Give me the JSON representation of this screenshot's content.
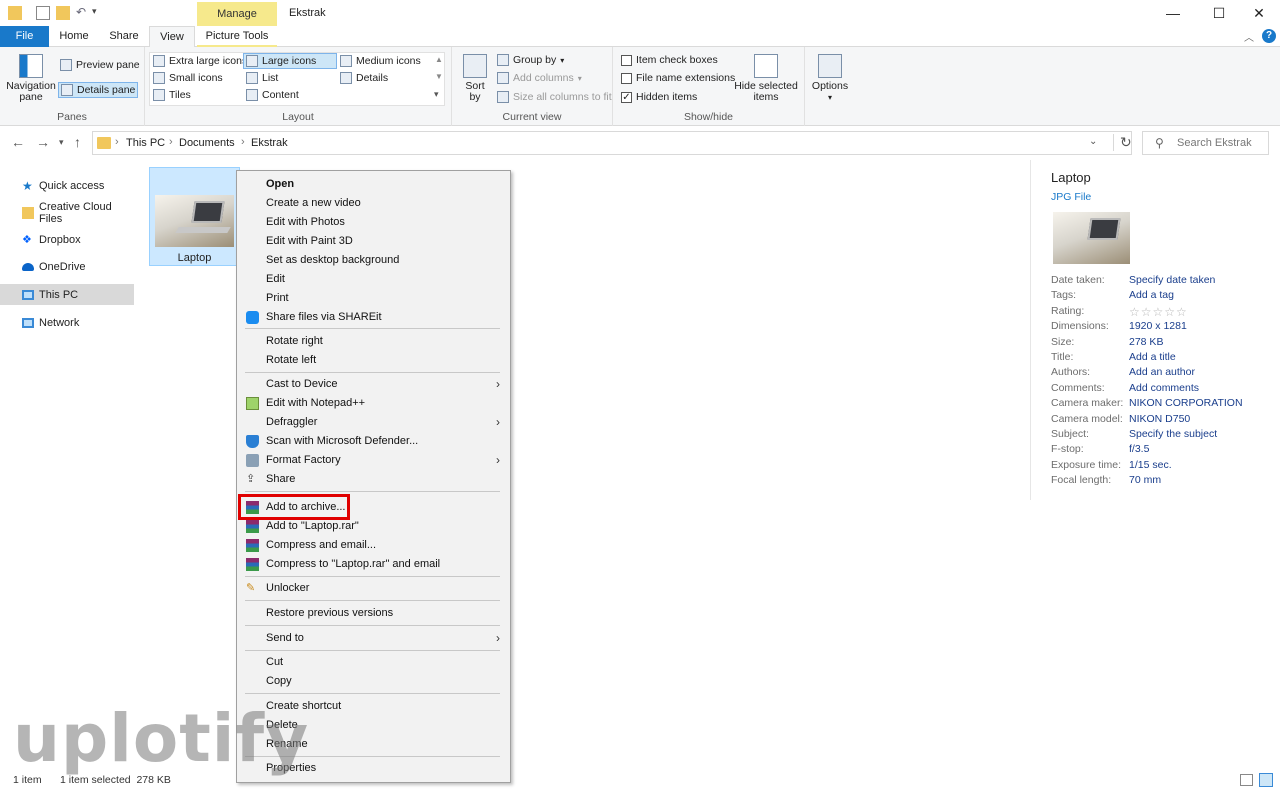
{
  "window": {
    "title": "Ekstrak",
    "contextual_tab": "Manage",
    "controls": {
      "minimize": "—",
      "maximize": "☐",
      "close": "✕"
    }
  },
  "ribbon_tabs": [
    "File",
    "Home",
    "Share",
    "View",
    "Picture Tools"
  ],
  "ribbon": {
    "panes": {
      "navigation": "Navigation pane",
      "preview": "Preview pane",
      "details": "Details pane",
      "label": "Panes"
    },
    "layout": {
      "items": [
        "Extra large icons",
        "Large icons",
        "Medium icons",
        "Small icons",
        "List",
        "Details",
        "Tiles",
        "Content"
      ],
      "selected": "Large icons",
      "label": "Layout"
    },
    "current_view": {
      "sort": "Sort by",
      "group": "Group by",
      "add_columns": "Add columns",
      "size_columns": "Size all columns to fit",
      "label": "Current view"
    },
    "show_hide": {
      "item_check_boxes": "Item check boxes",
      "file_name_extensions": "File name extensions",
      "hidden_items": "Hidden items",
      "hide_selected": "Hide selected items",
      "label": "Show/hide"
    },
    "options": "Options"
  },
  "address": {
    "crumbs": [
      "This PC",
      "Documents",
      "Ekstrak"
    ],
    "search_placeholder": "Search Ekstrak"
  },
  "sidebar": {
    "items": [
      "Quick access",
      "Creative Cloud Files",
      "Dropbox",
      "OneDrive",
      "This PC",
      "Network"
    ],
    "active": "This PC"
  },
  "file": {
    "name": "Laptop"
  },
  "context_menu": {
    "items": [
      "Open",
      "Create a new video",
      "Edit with Photos",
      "Edit with Paint 3D",
      "Set as desktop background",
      "Edit",
      "Print",
      "Share files via SHAREit",
      "Rotate right",
      "Rotate left",
      "Cast to Device",
      "Edit with Notepad++",
      "Defraggler",
      "Scan with Microsoft Defender...",
      "Format Factory",
      "Share",
      "Add to archive...",
      "Add to \"Laptop.rar\"",
      "Compress and email...",
      "Compress to \"Laptop.rar\" and email",
      "Unlocker",
      "Restore previous versions",
      "Send to",
      "Cut",
      "Copy",
      "Create shortcut",
      "Delete",
      "Rename",
      "Properties"
    ],
    "highlighted": "Add to archive...",
    "highlight_color": "#e00000"
  },
  "details": {
    "title": "Laptop",
    "type": "JPG File",
    "properties": [
      {
        "key": "Date taken:",
        "value": "Specify date taken"
      },
      {
        "key": "Tags:",
        "value": "Add a tag"
      },
      {
        "key": "Rating:",
        "value": "☆☆☆☆☆"
      },
      {
        "key": "Dimensions:",
        "value": "1920 x 1281"
      },
      {
        "key": "Size:",
        "value": "278 KB"
      },
      {
        "key": "Title:",
        "value": "Add a title"
      },
      {
        "key": "Authors:",
        "value": "Add an author"
      },
      {
        "key": "Comments:",
        "value": "Add comments"
      },
      {
        "key": "Camera maker:",
        "value": "NIKON CORPORATION"
      },
      {
        "key": "Camera model:",
        "value": "NIKON D750"
      },
      {
        "key": "Subject:",
        "value": "Specify the subject"
      },
      {
        "key": "F-stop:",
        "value": "f/3.5"
      },
      {
        "key": "Exposure time:",
        "value": "1/15 sec."
      },
      {
        "key": "Focal length:",
        "value": "70 mm"
      }
    ]
  },
  "status": {
    "count": "1 item",
    "selected": "1 item selected  278 KB"
  },
  "watermark": "uplotify",
  "colors": {
    "accent": "#1979ca",
    "manage": "#f6e98c",
    "selection": "#cce8ff"
  }
}
